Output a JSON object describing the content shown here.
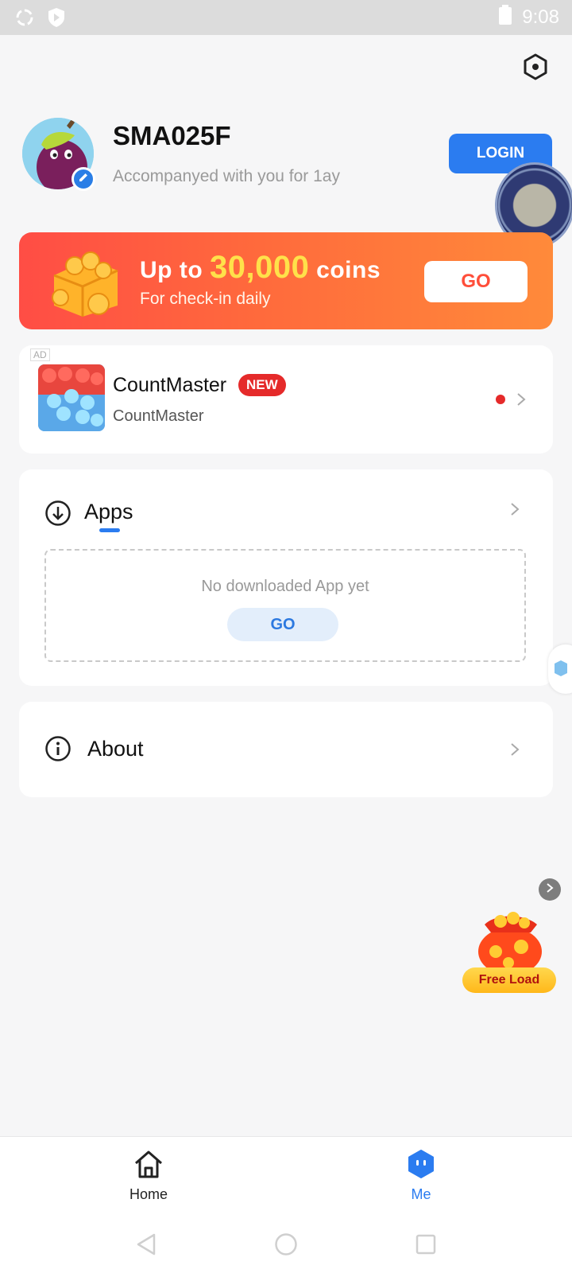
{
  "status_bar": {
    "time": "9:08",
    "left_icons": [
      "sync-icon",
      "shield-play-icon"
    ],
    "right_icons": [
      "battery-icon"
    ]
  },
  "profile": {
    "username": "SMA025F",
    "subtitle": "Accompanyed with you for  1ay",
    "login_label": "LOGIN"
  },
  "banner": {
    "title_prefix": "Up to",
    "title_amount": "30,000",
    "title_suffix": "coins",
    "subtitle": "For  check-in daily",
    "go_label": "GO"
  },
  "ad_card": {
    "ad_tag": "AD",
    "title": "CountMaster",
    "badge": "NEW",
    "subtitle": "CountMaster"
  },
  "apps_card": {
    "label": "Apps",
    "empty_text": "No downloaded App yet",
    "go_label": "GO"
  },
  "about_card": {
    "label": "About"
  },
  "floating": {
    "free_load_label": "Free Load"
  },
  "bottom_nav": {
    "items": [
      {
        "label": "Home",
        "icon": "home-icon",
        "active": false
      },
      {
        "label": "Me",
        "icon": "me-icon",
        "active": true
      }
    ]
  },
  "colors": {
    "accent": "#2b7cf0",
    "banner_start": "#ff4d45",
    "banner_end": "#ff8a3a",
    "badge_red": "#e52a2a",
    "coins_yellow": "#ffe14a"
  }
}
